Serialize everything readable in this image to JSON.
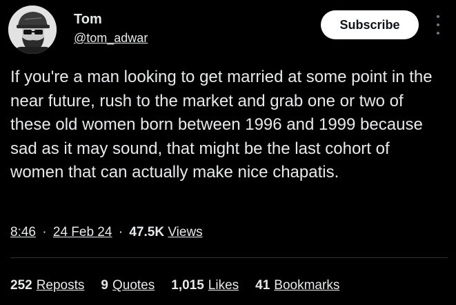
{
  "author": {
    "display_name": "Tom",
    "handle": "@tom_adwar"
  },
  "header": {
    "subscribe_label": "Subscribe",
    "more_icon": "more-vertical-icon"
  },
  "tweet": {
    "text": "If you're a man looking to get married at some point in the near future, rush to the market and grab one or two of these old women born between 1996 and 1999 because sad as it may sound, that might be the last cohort of women that can actually make nice chapatis."
  },
  "meta": {
    "time": "8:46",
    "date": "24 Feb 24",
    "separator": "·",
    "views_count": "47.5K",
    "views_label": "Views"
  },
  "stats": {
    "reposts": {
      "count": "252",
      "label": "Reposts"
    },
    "quotes": {
      "count": "9",
      "label": "Quotes"
    },
    "likes": {
      "count": "1,015",
      "label": "Likes"
    },
    "bookmarks": {
      "count": "41",
      "label": "Bookmarks"
    }
  },
  "colors": {
    "background": "#000000",
    "text": "#e7e9ea",
    "button_bg": "#ffffff",
    "button_text": "#0f1419",
    "divider": "#2f3336"
  }
}
